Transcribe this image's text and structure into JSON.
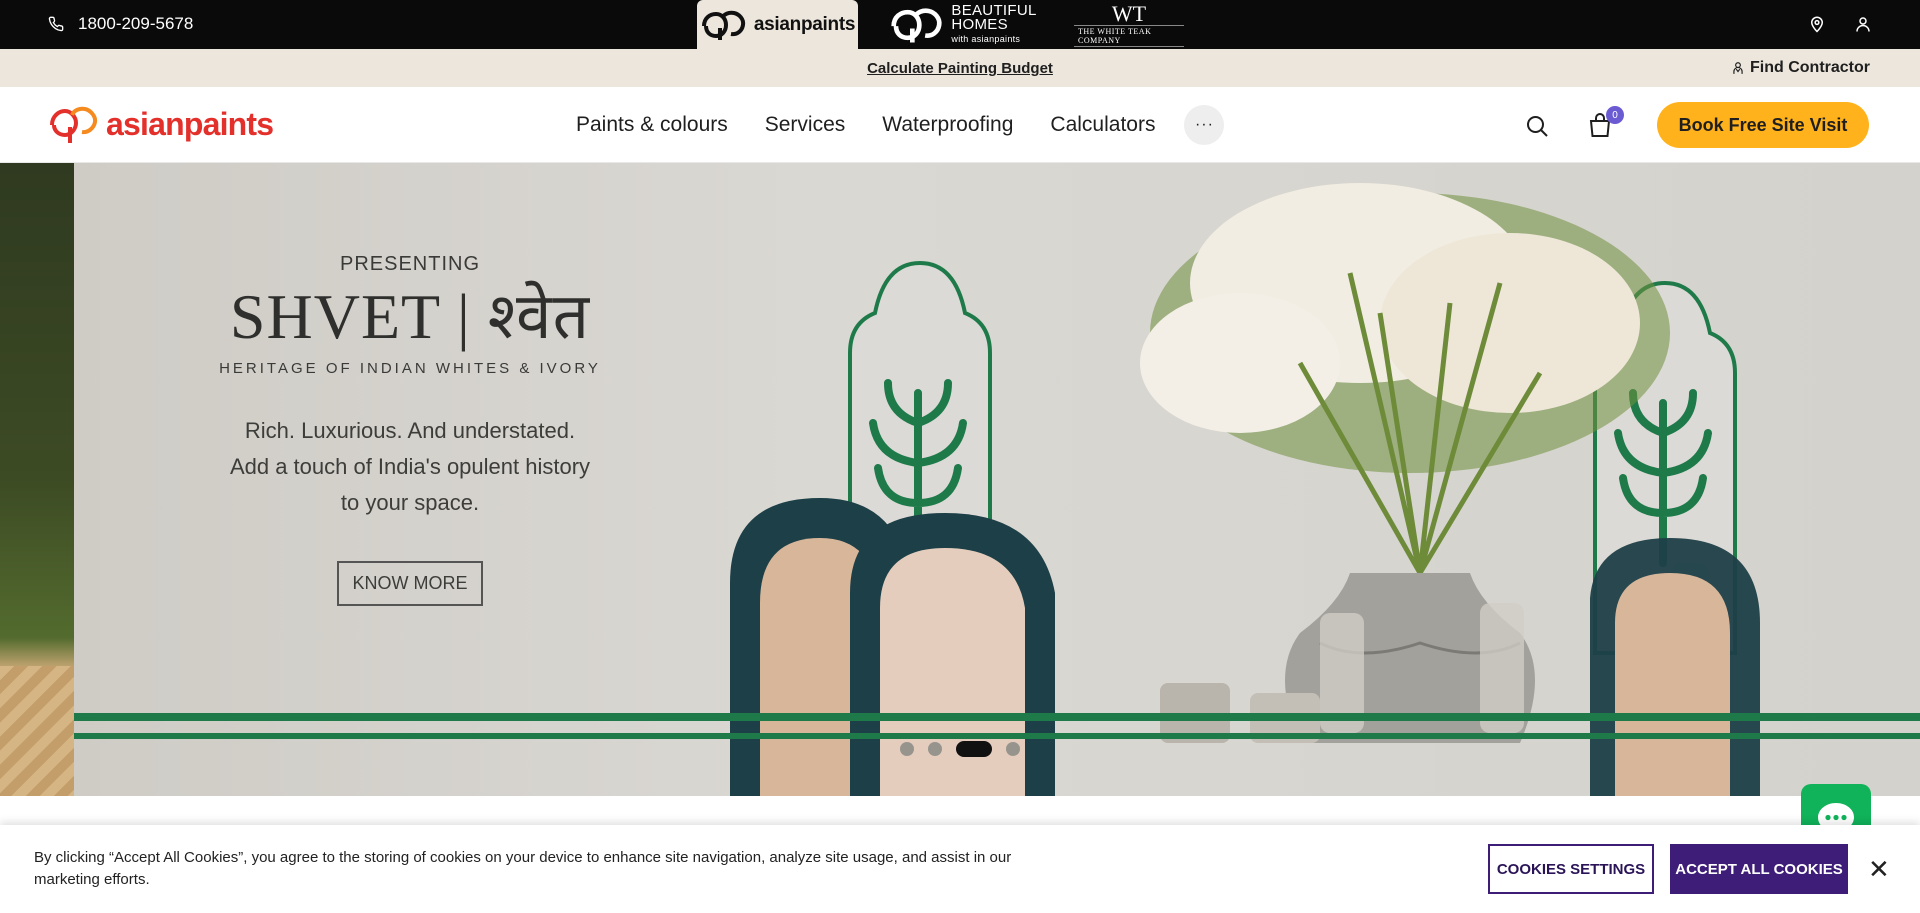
{
  "topbar": {
    "phone": "1800-209-5678",
    "brands": [
      {
        "name": "asianpaints"
      },
      {
        "line1": "BEAUTIFUL",
        "line2": "HOMES",
        "line3": "with asianpaints"
      },
      {
        "mark": "WT",
        "name": "THE WHITE TEAK COMPANY"
      }
    ]
  },
  "subbar": {
    "budget_link": "Calculate Painting Budget",
    "find_contractor": "Find Contractor"
  },
  "nav": {
    "logo_text": "asianpaints",
    "menu": [
      "Paints & colours",
      "Services",
      "Waterproofing",
      "Calculators"
    ],
    "more": "···",
    "cart_count": "0",
    "cta": "Book Free Site Visit"
  },
  "hero": {
    "presenting": "PRESENTING",
    "title": "SHVET | श्वेत",
    "subtitle": "HERITAGE OF INDIAN WHITES & IVORY",
    "tagline_1": "Rich. Luxurious. And understated.",
    "tagline_2": "Add a touch of India's opulent history",
    "tagline_3": "to your space.",
    "button": "KNOW MORE",
    "slides_total": 4,
    "active_slide": 3
  },
  "cookie": {
    "text": "By clicking “Accept All Cookies”, you agree to the storing of cookies on your device to enhance site navigation, analyze site usage, and assist in our marketing efforts.",
    "settings_label": "COOKIES SETTINGS",
    "accept_label": "ACCEPT ALL COOKIES",
    "close": "✕"
  },
  "colors": {
    "brand_red": "#e4302b",
    "cta_yellow": "#ffb21c",
    "cookie_purple": "#3e1d78",
    "chat_green": "#10b35a"
  }
}
